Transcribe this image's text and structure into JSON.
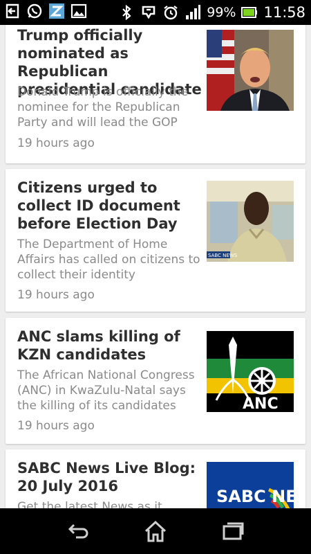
{
  "status_bar": {
    "left_icons": [
      "back-arrow-notification-icon",
      "whatsapp-icon",
      "z-app-icon",
      "gallery-icon"
    ],
    "right_icons": [
      "bluetooth-icon",
      "mirroring-icon",
      "alarm-icon",
      "signal-icon",
      "battery-icon"
    ],
    "battery_percent": "99%",
    "time": "11:58"
  },
  "feed": {
    "articles": [
      {
        "title": "Trump officially nominated as Republican presidential candidate",
        "summary": "Donald Trump is officially the nominee for the Republican Party and will lead the GOP",
        "time": "19 hours ago",
        "thumbnail": "trump-photo"
      },
      {
        "title": "Citizens urged to collect ID document before Election Day",
        "summary": "The Department of Home Affairs has called on citizens to collect their identity",
        "time": "19 hours ago",
        "thumbnail": "home-affairs-photo",
        "thumbnail_caption": "SABC NEWS"
      },
      {
        "title": "ANC slams killing of KZN candidates",
        "summary": "The African National Congress (ANC) in KwaZulu-Natal says the killing of its candidates",
        "time": "19 hours ago",
        "thumbnail": "anc-logo",
        "thumbnail_caption": "ANC"
      },
      {
        "title": "SABC News Live Blog: 20 July 2016",
        "summary": "Get the latest News as it",
        "thumbnail": "sabc-news-logo",
        "thumbnail_caption": "SABC NEWS"
      }
    ]
  },
  "nav_bar": {
    "buttons": [
      "back-icon",
      "home-icon",
      "recent-apps-icon"
    ]
  },
  "colors": {
    "status_bar_bg": "#000000",
    "card_bg": "#ffffff",
    "feed_bg": "#eeeeee",
    "title_color": "#2f2f2f",
    "meta_color": "#8a8a8a",
    "battery_green": "#7ed321"
  }
}
